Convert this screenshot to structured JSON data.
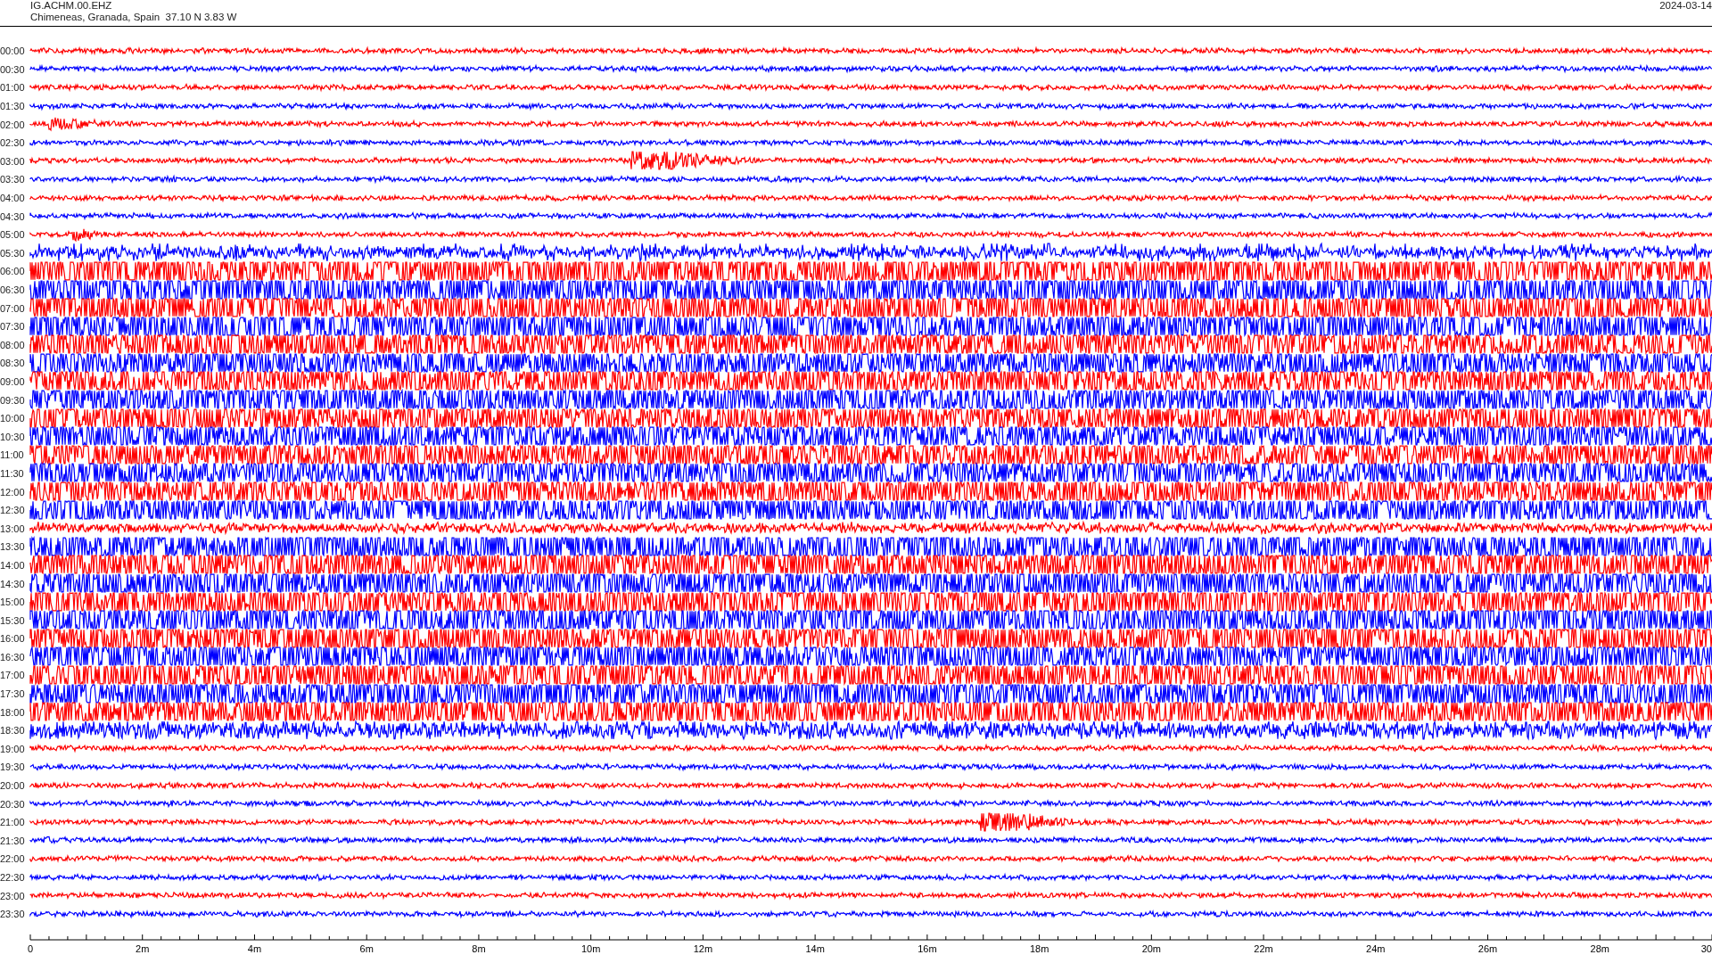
{
  "header": {
    "station": "IG.ACHM.00.EHZ",
    "location": "Chimeneas, Granada, Spain  37.10 N 3.83 W",
    "date": "2024-03-14"
  },
  "traces": [
    {
      "label": "00:00",
      "color": "#ff0000"
    },
    {
      "label": "00:30",
      "color": "#0000ff"
    },
    {
      "label": "01:00",
      "color": "#ff0000"
    },
    {
      "label": "01:30",
      "color": "#0000ff"
    },
    {
      "label": "02:00",
      "color": "#ff0000"
    },
    {
      "label": "02:30",
      "color": "#0000ff"
    },
    {
      "label": "03:00",
      "color": "#ff0000"
    },
    {
      "label": "03:30",
      "color": "#0000ff"
    },
    {
      "label": "04:00",
      "color": "#ff0000"
    },
    {
      "label": "04:30",
      "color": "#0000ff"
    },
    {
      "label": "05:00",
      "color": "#ff0000"
    },
    {
      "label": "05:30",
      "color": "#0000ff"
    },
    {
      "label": "06:00",
      "color": "#ff0000"
    },
    {
      "label": "06:30",
      "color": "#0000ff"
    },
    {
      "label": "07:00",
      "color": "#ff0000"
    },
    {
      "label": "07:30",
      "color": "#0000ff"
    },
    {
      "label": "08:00",
      "color": "#ff0000"
    },
    {
      "label": "08:30",
      "color": "#0000ff"
    },
    {
      "label": "09:00",
      "color": "#ff0000"
    },
    {
      "label": "09:30",
      "color": "#0000ff"
    },
    {
      "label": "10:00",
      "color": "#ff0000"
    },
    {
      "label": "10:30",
      "color": "#0000ff"
    },
    {
      "label": "11:00",
      "color": "#ff0000"
    },
    {
      "label": "11:30",
      "color": "#0000ff"
    },
    {
      "label": "12:00",
      "color": "#ff0000"
    },
    {
      "label": "12:30",
      "color": "#0000ff"
    },
    {
      "label": "13:00",
      "color": "#ff0000"
    },
    {
      "label": "13:30",
      "color": "#0000ff"
    },
    {
      "label": "14:00",
      "color": "#ff0000"
    },
    {
      "label": "14:30",
      "color": "#0000ff"
    },
    {
      "label": "15:00",
      "color": "#ff0000"
    },
    {
      "label": "15:30",
      "color": "#0000ff"
    },
    {
      "label": "16:00",
      "color": "#ff0000"
    },
    {
      "label": "16:30",
      "color": "#0000ff"
    },
    {
      "label": "17:00",
      "color": "#ff0000"
    },
    {
      "label": "17:30",
      "color": "#0000ff"
    },
    {
      "label": "18:00",
      "color": "#ff0000"
    },
    {
      "label": "18:30",
      "color": "#0000ff"
    },
    {
      "label": "19:00",
      "color": "#ff0000"
    },
    {
      "label": "19:30",
      "color": "#0000ff"
    },
    {
      "label": "20:00",
      "color": "#ff0000"
    },
    {
      "label": "20:30",
      "color": "#0000ff"
    },
    {
      "label": "21:00",
      "color": "#ff0000"
    },
    {
      "label": "21:30",
      "color": "#0000ff"
    },
    {
      "label": "22:00",
      "color": "#ff0000"
    },
    {
      "label": "22:30",
      "color": "#0000ff"
    },
    {
      "label": "23:00",
      "color": "#ff0000"
    },
    {
      "label": "23:30",
      "color": "#0000ff"
    }
  ],
  "axis": {
    "ticks": [
      "0",
      "2m",
      "4m",
      "6m",
      "8m",
      "10m",
      "12m",
      "14m",
      "16m",
      "18m",
      "20m",
      "22m",
      "24m",
      "26m",
      "28m",
      "30"
    ]
  }
}
